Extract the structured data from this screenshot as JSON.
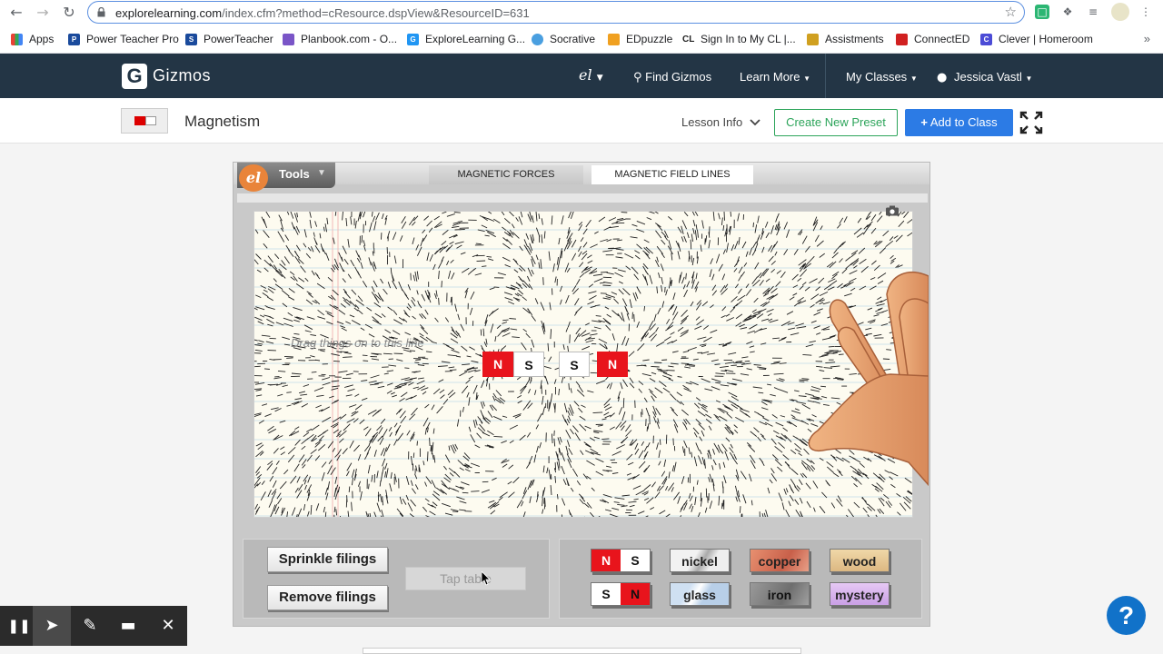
{
  "browser": {
    "url_host": "explorelearning.com",
    "url_path": "/index.cfm?method=cResource.dspView&ResourceID=631",
    "bookmarks": [
      {
        "label": "Apps",
        "color": "#e94235"
      },
      {
        "label": "Power Teacher Pro",
        "color": "#1a4a9c"
      },
      {
        "label": "PowerTeacher",
        "color": "#1a4a9c"
      },
      {
        "label": "Planbook.com - O...",
        "color": "#7a55c7"
      },
      {
        "label": "ExploreLearning G...",
        "color": "#2196f3"
      },
      {
        "label": "Socrative",
        "color": "#4a9fe0"
      },
      {
        "label": "EDpuzzle",
        "color": "#f0a020"
      },
      {
        "label": "Sign In to My CL |...",
        "color": "#222222"
      },
      {
        "label": "Assistments",
        "color": "#d0a020"
      },
      {
        "label": "ConnectED",
        "color": "#d12020"
      },
      {
        "label": "Clever | Homeroom",
        "color": "#4b4bd6"
      }
    ],
    "bookmarks_more": "»"
  },
  "header": {
    "brand": "Gizmos",
    "logo_letter": "G",
    "el_logo": "el",
    "find_gizmos": "Find Gizmos",
    "learn_more": "Learn More",
    "my_classes": "My Classes",
    "user": "Jessica Vastl"
  },
  "subheader": {
    "title": "Magnetism",
    "lesson_info": "Lesson Info",
    "create_preset": "Create New Preset",
    "add_to_class": "Add to Class"
  },
  "sim": {
    "tools_logo": "el",
    "tools_label": "Tools",
    "tabs": {
      "forces": "MAGNETIC FORCES",
      "field_lines": "MAGNETIC FIELD LINES"
    },
    "drag_hint": "Drag things on to this line",
    "magnets_on_line": [
      {
        "left": "N",
        "right": "S"
      },
      {
        "left": "S",
        "right": "N"
      }
    ],
    "buttons": {
      "sprinkle": "Sprinkle filings",
      "remove": "Remove filings",
      "tap": "Tap table"
    },
    "objects": {
      "magnet_ns": {
        "left": "N",
        "right": "S"
      },
      "magnet_sn": {
        "left": "S",
        "right": "N"
      },
      "nickel": "nickel",
      "copper": "copper",
      "wood": "wood",
      "glass": "glass",
      "iron": "iron",
      "mystery": "mystery"
    }
  },
  "help_label": "?",
  "colors": {
    "header_bg": "#233545",
    "accent_green": "#2ca45a",
    "accent_blue": "#2c7be5",
    "magnet_red": "#e8141c"
  }
}
